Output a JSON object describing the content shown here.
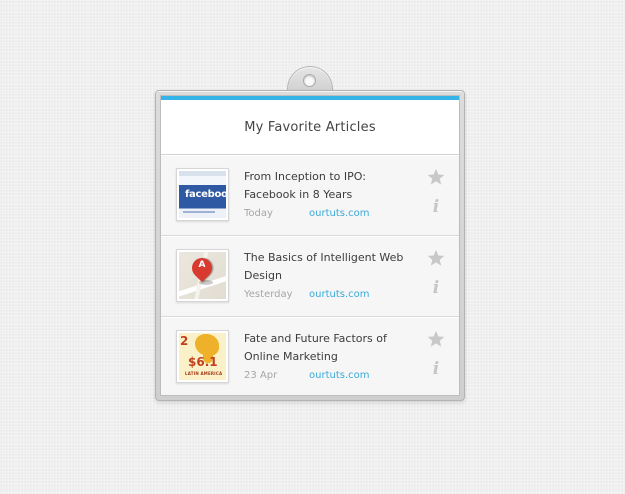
{
  "widget": {
    "title": "My Favorite Articles",
    "accent_color": "#35b4e8"
  },
  "articles": [
    {
      "title": "From Inception to IPO: Facebook in 8 Years",
      "date": "Today",
      "site": "ourtuts.com",
      "thumbnail": {
        "kind": "facebook-screenshot",
        "logo_text": "facebook"
      }
    },
    {
      "title": "The Basics of Intelligent Web Design",
      "date": "Yesterday",
      "site": "ourtuts.com",
      "thumbnail": {
        "kind": "map-pin",
        "pin_letter": "A"
      }
    },
    {
      "title": "Fate and Future Factors of Online Marketing",
      "date": "23 Apr",
      "site": "ourtuts.com",
      "thumbnail": {
        "kind": "infographic",
        "number": "2",
        "amount": "$6.1",
        "caption": "LATIN AMERICA"
      }
    }
  ],
  "icons": {
    "favorite": "star-icon",
    "info": "info-icon",
    "info_glyph": "i",
    "hanger": "hanger-hole-icon"
  }
}
